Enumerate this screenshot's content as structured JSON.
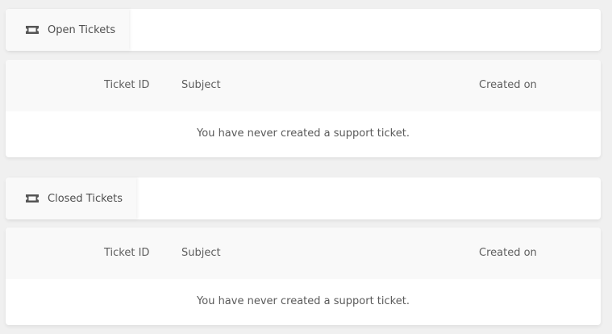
{
  "open_section": {
    "tab_label": "Open Tickets",
    "tab_icon": "ticket-icon",
    "columns": [
      "Ticket ID",
      "Subject",
      "Created on"
    ],
    "empty_message": "You have never created a support ticket."
  },
  "closed_section": {
    "tab_label": "Closed Tickets",
    "tab_icon": "ticket-icon",
    "columns": [
      "Ticket ID",
      "Subject",
      "Created on"
    ],
    "empty_message": "You have never created a support ticket."
  },
  "colors": {
    "page_background": "#f0f0f0",
    "card_background": "#ffffff",
    "header_background": "#f9f9f9",
    "icon_color": "#555555"
  }
}
